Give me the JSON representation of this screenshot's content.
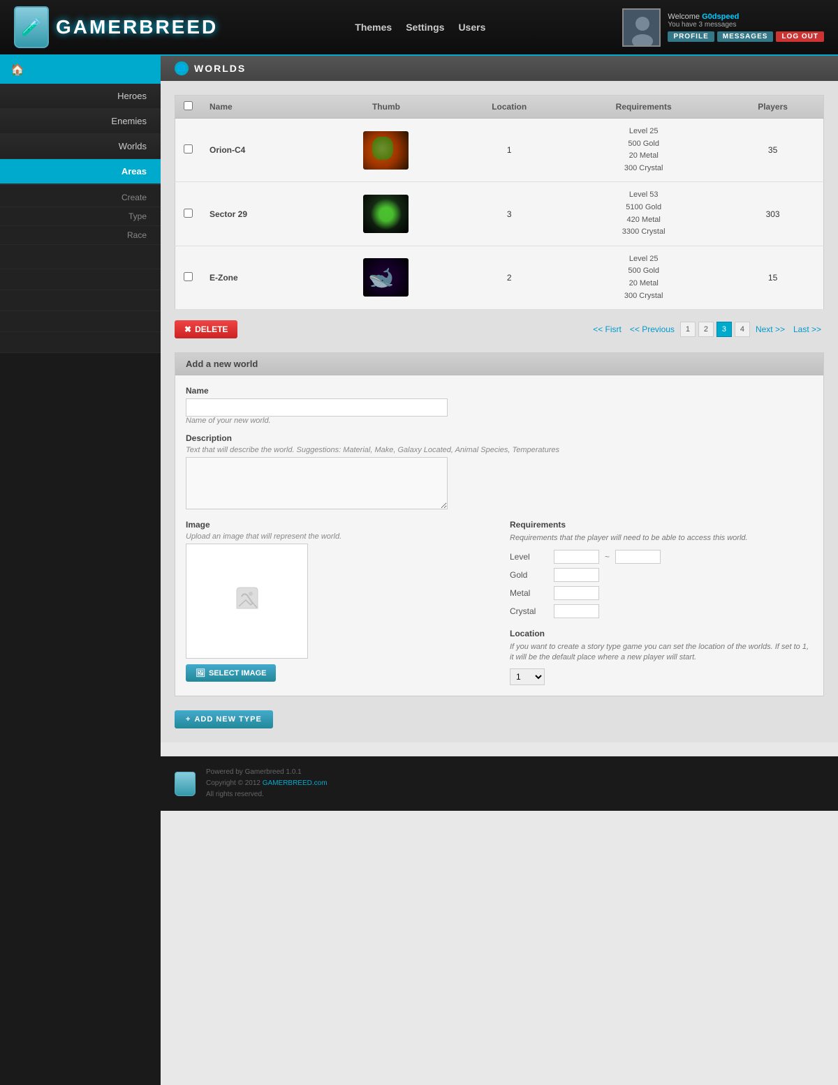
{
  "header": {
    "logo_text": "GAMERBREED",
    "nav": [
      {
        "label": "Themes",
        "id": "themes"
      },
      {
        "label": "Settings",
        "id": "settings"
      },
      {
        "label": "Users",
        "id": "users"
      }
    ],
    "user": {
      "welcome": "Welcome ",
      "username": "G0dspeed",
      "message_line": "You have 3 messages",
      "profile_btn": "PROFILE",
      "messages_btn": "MESSAGES",
      "logout_btn": "LOG OUT"
    }
  },
  "sidebar": {
    "nav_items": [
      {
        "label": "Heroes",
        "id": "heroes",
        "active": false
      },
      {
        "label": "Enemies",
        "id": "enemies",
        "active": false
      },
      {
        "label": "Worlds",
        "id": "worlds",
        "active": false
      },
      {
        "label": "Areas",
        "id": "areas",
        "active": true
      }
    ],
    "sub_items": [
      {
        "label": "Create",
        "id": "create"
      },
      {
        "label": "Type",
        "id": "type"
      },
      {
        "label": "Race",
        "id": "race"
      }
    ]
  },
  "page_title": "WORLDS",
  "table": {
    "columns": [
      "",
      "Name",
      "Thumb",
      "Location",
      "Requirements",
      "Players"
    ],
    "rows": [
      {
        "id": 1,
        "name": "Orion-C4",
        "location": "1",
        "requirements": "Level 25\n500 Gold\n20 Metal\n300 Crystal",
        "players": "35",
        "thumb_type": "orion"
      },
      {
        "id": 2,
        "name": "Sector 29",
        "location": "3",
        "requirements": "Level 53\n5100 Gold\n420 Metal\n3300 Crystal",
        "players": "303",
        "thumb_type": "sector"
      },
      {
        "id": 3,
        "name": "E-Zone",
        "location": "2",
        "requirements": "Level 25\n500 Gold\n20 Metal\n300 Crystal",
        "players": "15",
        "thumb_type": "ezone"
      }
    ]
  },
  "pagination": {
    "first": "<< Fisrt",
    "previous": "<< Previous",
    "pages": [
      "1",
      "2",
      "3",
      "4"
    ],
    "active_page": "3",
    "next": "Next >>",
    "last": "Last >>"
  },
  "delete_btn": "DELETE",
  "add_world_form": {
    "section_title": "Add a new world",
    "name_label": "Name",
    "name_placeholder": "",
    "name_hint": "Name of your new world.",
    "description_label": "Description",
    "description_hint": "Text that will describe the world. Suggestions: Material, Make, Galaxy Located, Animal Species, Temperatures",
    "image_label": "Image",
    "image_hint": "Upload an image that will represent the world.",
    "select_image_btn": "SELECT IMAGE",
    "requirements_label": "Requirements",
    "requirements_hint": "Requirements that the player will need to be able to access this world.",
    "level_label": "Level",
    "gold_label": "Gold",
    "metal_label": "Metal",
    "crystal_label": "Crystal",
    "location_label": "Location",
    "location_hint": "If you want to create a story type game you can set the location of the worlds. If set to 1, it will be the default place where a new player will start.",
    "location_default": "1"
  },
  "add_type_btn": "ADD NEW TYPE",
  "footer": {
    "powered_by": "Powered by Gamerbreed 1.0.1",
    "copyright": "Copyright © 2012 ",
    "copyright_link": "GAMERBREED.com",
    "rights": "All rights reserved."
  }
}
